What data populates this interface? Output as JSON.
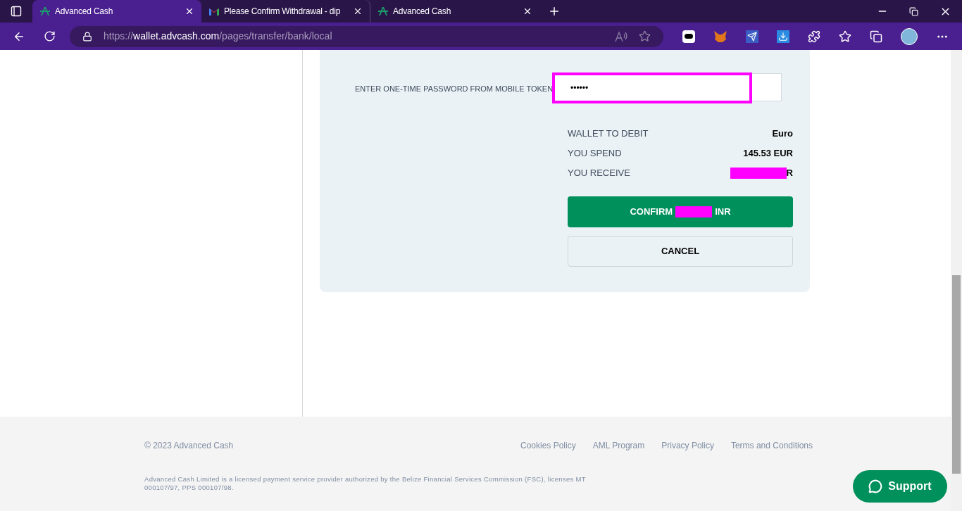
{
  "browser": {
    "tabs": [
      {
        "title": "Advanced Cash",
        "kind": "wallet",
        "selected": true
      },
      {
        "title": "Please Confirm Withdrawal - dip",
        "kind": "mail",
        "selected": false
      },
      {
        "title": "Advanced Cash",
        "kind": "wallet",
        "selected": false
      }
    ],
    "url": {
      "host": "wallet.advcash.com",
      "scheme": "https://",
      "path": "/pages/transfer/bank/local"
    }
  },
  "form": {
    "otp_label": "ENTER ONE-TIME PASSWORD FROM MOBILE TOKEN",
    "otp_value": "••••••",
    "otp_highlighted": true,
    "summary": [
      {
        "label": "WALLET TO DEBIT",
        "value": "Euro",
        "redacted": false
      },
      {
        "label": "YOU SPEND",
        "value": "145.53 EUR",
        "redacted": false
      },
      {
        "label": "YOU RECEIVE",
        "value": "R",
        "redacted": true
      }
    ],
    "confirm": {
      "prefix": "CONFIRM",
      "suffix": "INR",
      "redacted": true
    },
    "cancel": "CANCEL"
  },
  "footer": {
    "copyright": "© 2023 Advanced Cash",
    "links": [
      "Cookies Policy",
      "AML Program",
      "Privacy Policy",
      "Terms and Conditions"
    ],
    "legal": "Advanced Cash Limited is a licensed payment service provider authorized by the Belize Financial Services Commission (FSC), licenses MT 000107/97, PPS 000107/98."
  },
  "support": "Support"
}
